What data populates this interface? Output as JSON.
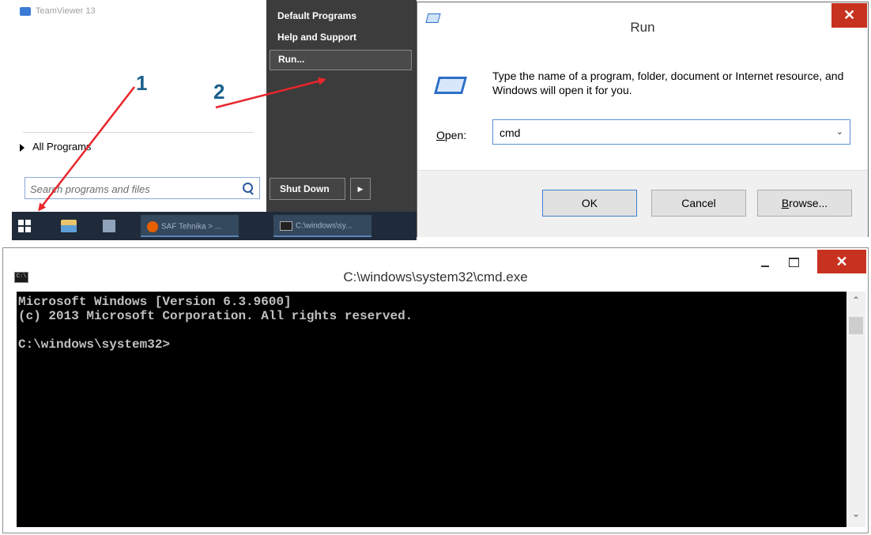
{
  "start_menu": {
    "pinned_app": "TeamViewer 13",
    "all_programs": "All Programs",
    "search_placeholder": "Search programs and files",
    "right_links": [
      "Default Programs",
      "Help and Support"
    ],
    "run": "Run...",
    "shutdown": "Shut Down",
    "shutdown_arrow": "▶"
  },
  "taskbar": {
    "items": [
      "SAF Tehnika > ...",
      "C:\\windows\\sy..."
    ]
  },
  "annotations": {
    "step1": "1",
    "step2": "2",
    "arrow_color": "#e8262b"
  },
  "run_dialog": {
    "title": "Run",
    "close": "✕",
    "description": "Type the name of a program, folder, document or Internet resource, and Windows will open it for you.",
    "open_label_accel": "O",
    "open_label_rest": "pen:",
    "open_value": "cmd",
    "dropdown_icon": "⌄",
    "ok": "OK",
    "cancel": "Cancel",
    "browse_accel": "B",
    "browse_rest": "rowse..."
  },
  "cmd_window": {
    "icon_text": "C:\\",
    "title": "C:\\windows\\system32\\cmd.exe",
    "close": "✕",
    "console_lines": [
      "Microsoft Windows [Version 6.3.9600]",
      "(c) 2013 Microsoft Corporation. All rights reserved.",
      "",
      "C:\\windows\\system32>"
    ],
    "scroll_up": "⌃",
    "scroll_down": "⌄"
  },
  "colors": {
    "close_red": "#c7311f",
    "taskbar": "#1f2b3a",
    "start_right_pane": "#3c3c3c"
  }
}
